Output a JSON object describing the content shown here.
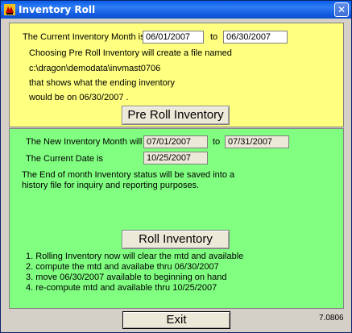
{
  "window": {
    "title": "Inventory Roll",
    "close_glyph": "✕"
  },
  "pre_roll": {
    "current_month_label": "The Current Inventory Month is",
    "start_date": "06/01/2007",
    "to_label": "to",
    "end_date": "06/30/2007",
    "desc_line1": "Choosing Pre Roll Inventory will create a file named",
    "desc_line2": "c:\\dragon\\demodata\\invmast0706",
    "desc_line3": "that shows what the ending inventory",
    "desc_line4": "would be on 06/30/2007 .",
    "button_label": "Pre Roll Inventory"
  },
  "roll": {
    "new_month_label": "The New Inventory Month will be",
    "new_start_date": "07/01/2007",
    "to_label": "to",
    "new_end_date": "07/31/2007",
    "current_date_label": "The Current Date is",
    "current_date": "10/25/2007",
    "info_line1": "The End of month Inventory status will be saved into a",
    "info_line2": "history file for inquiry and reporting purposes.",
    "button_label": "Roll Inventory",
    "steps": [
      "1. Rolling Inventory now will clear the mtd and available",
      "2. compute the mtd and availabe thru 06/30/2007",
      "3. move 06/30/2007 available to beginning on hand",
      "4. re-compute mtd and available thru 10/25/2007"
    ]
  },
  "footer": {
    "exit_label": "Exit",
    "version": "7.0806"
  },
  "colors": {
    "pre_roll_panel": "#ffff80",
    "roll_panel": "#80ff80",
    "titlebar": "#0a5ce8"
  }
}
